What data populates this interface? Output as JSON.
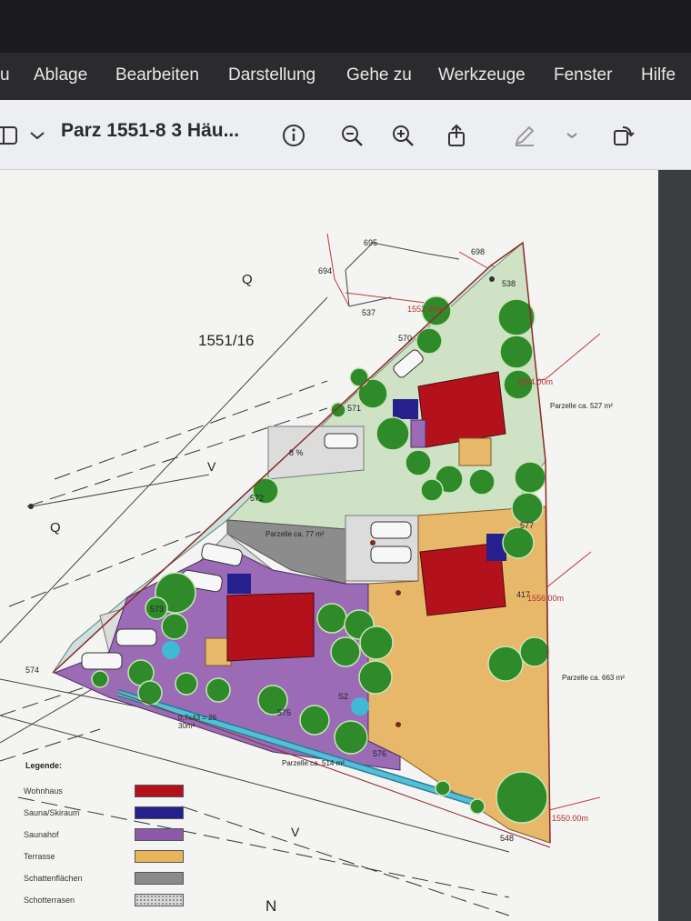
{
  "menubar": {
    "items": [
      "u",
      "Ablage",
      "Bearbeiten",
      "Darstellung",
      "Gehe zu",
      "Werkzeuge",
      "Fenster",
      "Hilfe"
    ]
  },
  "toolbar": {
    "title": "Parz 1551-8 3 Häu...",
    "icons": [
      "sidebar-icon",
      "chevron-down-icon",
      "info-icon",
      "zoom-out-icon",
      "zoom-in-icon",
      "share-icon",
      "markup-pen-icon",
      "chevron-down-icon",
      "rotate-icon"
    ]
  },
  "plan": {
    "parcel_main": "1551/16",
    "letters": [
      "Q",
      "Q",
      "V",
      "V",
      "N"
    ],
    "marks_mm": [
      "694",
      "695",
      "698",
      "537",
      "538",
      "570",
      "571",
      "572",
      "573",
      "574",
      "575",
      "576",
      "577",
      "548"
    ],
    "elevations": [
      "1552.00m",
      "1554.00m",
      "1556.00m",
      "1550.00m"
    ],
    "parcels": [
      "Parzelle ca. 527 m²",
      "Parzelle ca. 663 m²",
      "Parzelle ca. 514 m²",
      "Parzelle ca. 77 m²"
    ],
    "other": [
      "8 %",
      "417",
      "S2",
      "0,7x43 = 26 30m²"
    ]
  },
  "legend": {
    "title": "Legende:",
    "items": [
      {
        "label": "Wohnhaus",
        "color": "#b3121d"
      },
      {
        "label": "Sauna/Skiraum",
        "color": "#26208c"
      },
      {
        "label": "Saunahof",
        "color": "#8c5aa8"
      },
      {
        "label": "Terrasse",
        "color": "#e8b65a"
      },
      {
        "label": "Schattenflächen",
        "color": "#8a8a8a"
      },
      {
        "label": "Schotterrasen",
        "color": "#d8d8d8"
      }
    ]
  },
  "compass": "N"
}
